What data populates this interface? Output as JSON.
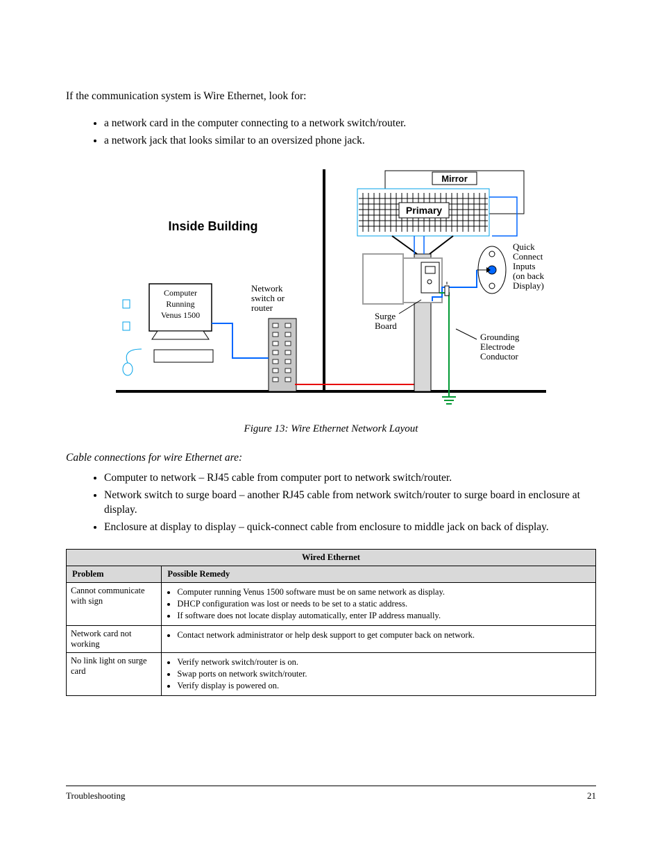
{
  "intro": "If the communication system is Wire Ethernet, look for:",
  "top_bullets": [
    "a network card in the computer connecting to a network switch/router.",
    "a network jack that looks similar to an oversized phone jack."
  ],
  "diagram": {
    "inside_building": "Inside Building",
    "computer_box": [
      "Computer",
      "Running",
      "Venus 1500"
    ],
    "network_box": [
      "Network",
      "switch or",
      "router"
    ],
    "mirror": "Mirror",
    "primary": "Primary",
    "surge": [
      "Surge",
      "Board"
    ],
    "quick_connect": [
      "Quick",
      "Connect",
      "Inputs",
      "(on back of",
      "Display)"
    ],
    "grounding": [
      "Grounding",
      "Electrode",
      "Conductor"
    ]
  },
  "figure_caption": "Figure 13: Wire Ethernet Network Layout",
  "cable_heading": "Cable connections for wire Ethernet are:",
  "cable_bullets": [
    "Computer to network – RJ45 cable from computer port to network switch/router.",
    "Network switch to surge board – another RJ45 cable from network switch/router to surge board in enclosure at display.",
    "Enclosure at display to display – quick-connect cable from enclosure to middle jack on back of display."
  ],
  "table": {
    "title": "Wired Ethernet",
    "col1": "Problem",
    "col2": "Possible Remedy",
    "rows": [
      {
        "problem": "Cannot communicate with sign",
        "remedies": [
          "Computer running Venus 1500 software must be on same network as display.",
          "DHCP configuration was lost or needs to be set to a static address.",
          "If software does not locate display automatically, enter IP address manually."
        ]
      },
      {
        "problem": "Network card not working",
        "remedies": [
          "Contact network administrator or help desk support to get computer back on network."
        ]
      },
      {
        "problem": "No link light on surge card",
        "remedies": [
          "Verify network switch/router is on.",
          "Swap ports on network switch/router.",
          "Verify display is powered on."
        ]
      }
    ]
  },
  "footer_left": "Troubleshooting",
  "footer_right": "21"
}
